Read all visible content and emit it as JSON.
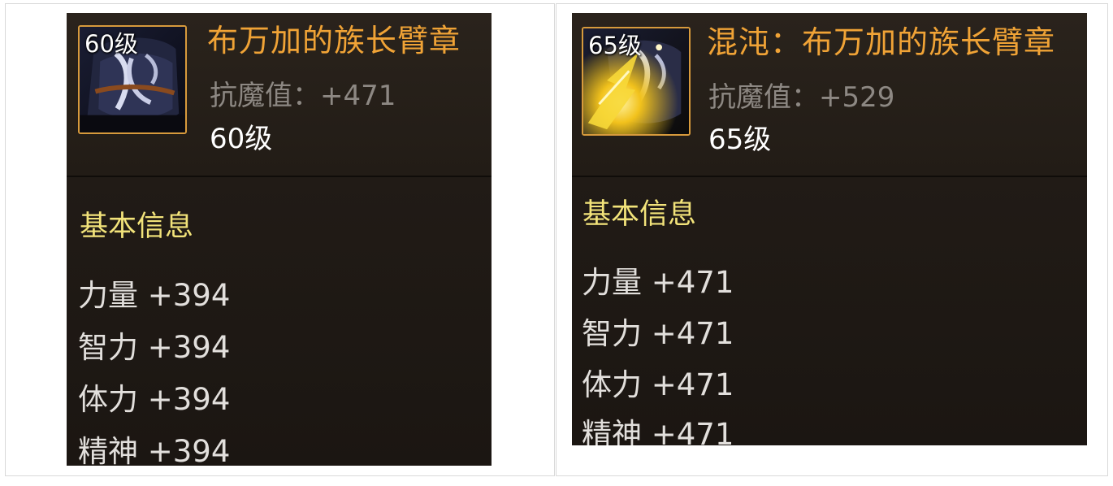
{
  "left_item": {
    "icon_level": "60级",
    "name": "布万加的族长臂章",
    "stat_label": "抗魔值：",
    "stat_value": "+471",
    "level": "60级",
    "section_title": "基本信息",
    "attributes": [
      {
        "label": "力量",
        "value": "+394"
      },
      {
        "label": "智力",
        "value": "+394"
      },
      {
        "label": "体力",
        "value": "+394"
      },
      {
        "label": "精神",
        "value": "+394"
      }
    ]
  },
  "right_item": {
    "icon_level": "65级",
    "name_prefix": "混沌：",
    "name": "布万加的族长臂章",
    "stat_label": "抗魔值：",
    "stat_value": "+529",
    "level": "65级",
    "section_title": "基本信息",
    "attributes": [
      {
        "label": "力量",
        "value": "+471"
      },
      {
        "label": "智力",
        "value": "+471"
      },
      {
        "label": "体力",
        "value": "+471"
      },
      {
        "label": "精神",
        "value": "+471"
      }
    ]
  },
  "colors": {
    "item_name": "#f0a336",
    "section_title": "#f2e37a",
    "stat_text": "#8d8883",
    "panel_bg": "#1c1713",
    "icon_border": "#d79a3c"
  },
  "icons": {
    "left": "armband-item-icon",
    "right": "chaos-armband-item-icon"
  }
}
